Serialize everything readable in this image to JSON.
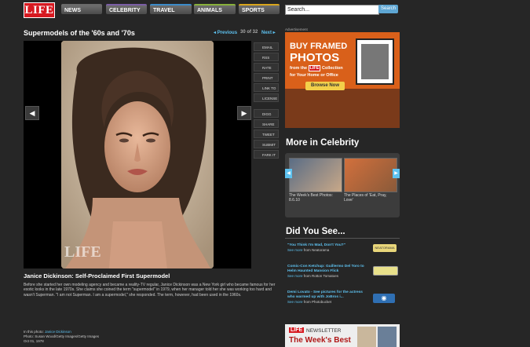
{
  "nav": {
    "logo": "LIFE",
    "tabs": [
      {
        "label": "NEWS",
        "color": "#6a6a6a"
      },
      {
        "label": "CELEBRITY",
        "color": "#7b5ea7"
      },
      {
        "label": "TRAVEL",
        "color": "#3c8bc9"
      },
      {
        "label": "ANIMALS",
        "color": "#88b13b"
      },
      {
        "label": "SPORTS",
        "color": "#d9a51c"
      }
    ],
    "search_placeholder": "Search...",
    "search_button": "Search"
  },
  "gallery": {
    "title": "Supermodels of the '60s and '70s",
    "prev": "Previous",
    "count": "30 of 32",
    "next": "Next",
    "side_actions": [
      "EMAIL",
      "RSS",
      "RATE",
      "PRINT",
      "LINK TO",
      "LICENSE"
    ],
    "share_actions": [
      "DIGG",
      "SHARE",
      "TWEET",
      "SUBMIT",
      "FARK IT"
    ],
    "watermark": "LIFE"
  },
  "caption": {
    "title": "Janice Dickinson: Self-Proclaimed First Supermodel",
    "body": "Before she started her own modeling agency and became a reality-TV regular, Janice Dickinson was a New York girl who became famous for her exotic looks in the late 1970s. She claims she coined the term \"supermodel\" in 1979, when her manager told her she was working too hard and wasn't Superman. \"I am not Superman. I am a supermodel,\" she responded. The term, however, had been used in the 1960s.",
    "in_photo_label": "In this photo:",
    "in_photo_name": "Janice Dickinson",
    "photo_credit": "Photo: Susan Wood/Getty Images/Getty Images",
    "date": "Oct 01, 1978"
  },
  "sidebar": {
    "ad_label": "Advertisement",
    "ad": {
      "line1": "BUY FRAMED",
      "line2": "PHOTOS",
      "line3a": "from the",
      "line3b": "LIFE",
      "line3c": "Collection",
      "line4": "for Your Home or Office",
      "button": "Browse Now"
    },
    "more_title": "More in Celebrity",
    "more_items": [
      {
        "caption": "The Week's Best Photos: 8.6.10"
      },
      {
        "caption": "The Places of 'Eat, Pray, Love'"
      }
    ],
    "dys_title": "Did You See...",
    "dys_items": [
      {
        "title": "\"You Think I'm Mad, Don't You?\"",
        "see_more": "See more",
        "from": "from Neatorama",
        "badge": "NEATORAMA"
      },
      {
        "title": "Comic-Con Ketchup: Guillermo Del Toro to Helm Haunted Mansion Flick",
        "see_more": "See more",
        "from": "from Rotton Tomatoes",
        "badge": ""
      },
      {
        "title": "Demi Lovato - See pictures for the actress who warmed up with JoBros i...",
        "see_more": "See more",
        "from": "from Photobucket",
        "badge": ""
      }
    ],
    "newsletter": {
      "brand": "LIFE",
      "label": "NEWSLETTER",
      "headline": "The Week's Best"
    }
  },
  "colors": {
    "accent_blue": "#5ec2f0",
    "life_red": "#d71920",
    "ad_orange": "#d9601a"
  }
}
